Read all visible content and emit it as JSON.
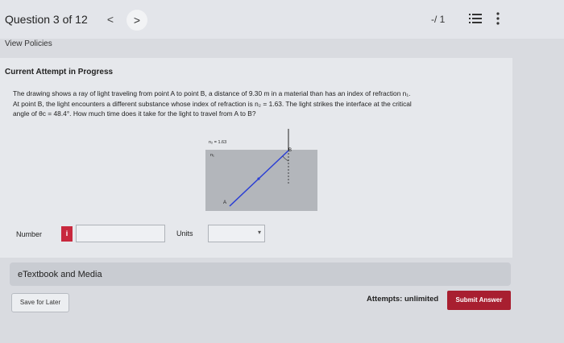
{
  "header": {
    "question_label": "Question 3 of 12",
    "prev_glyph": "<",
    "next_glyph": ">",
    "score": "-/ 1",
    "icons": [
      "list-icon",
      "more-vertical-icon"
    ]
  },
  "links": {
    "view_policies": "View Policies"
  },
  "attempt": {
    "heading": "Current Attempt in Progress"
  },
  "question": {
    "line1": "The drawing shows a ray of light traveling from point A to point B, a distance of 9.30 m in a material than has an index of refraction n₁.",
    "line2": "At point B, the light encounters a different substance whose index of refraction is n₂ = 1.63. The light strikes the interface at the critical",
    "line3": "angle of θc = 48.4°. How much time does it take for the light to travel from A to B?"
  },
  "figure": {
    "n2_label": "n₂ = 1.63",
    "n1_label": "n₁",
    "point_a": "A",
    "point_b": "B",
    "ray_color": "#2b3fd4",
    "medium_color": "#b3b6bb"
  },
  "answer": {
    "number_label": "Number",
    "info_badge": "i",
    "number_value": "",
    "units_label": "Units",
    "units_value": ""
  },
  "etextbook": {
    "label": "eTextbook and Media"
  },
  "footer": {
    "save_label": "Save for Later",
    "attempts_text": "Attempts: unlimited",
    "submit_label": "Submit Answer",
    "submit_color": "#a81f30"
  }
}
